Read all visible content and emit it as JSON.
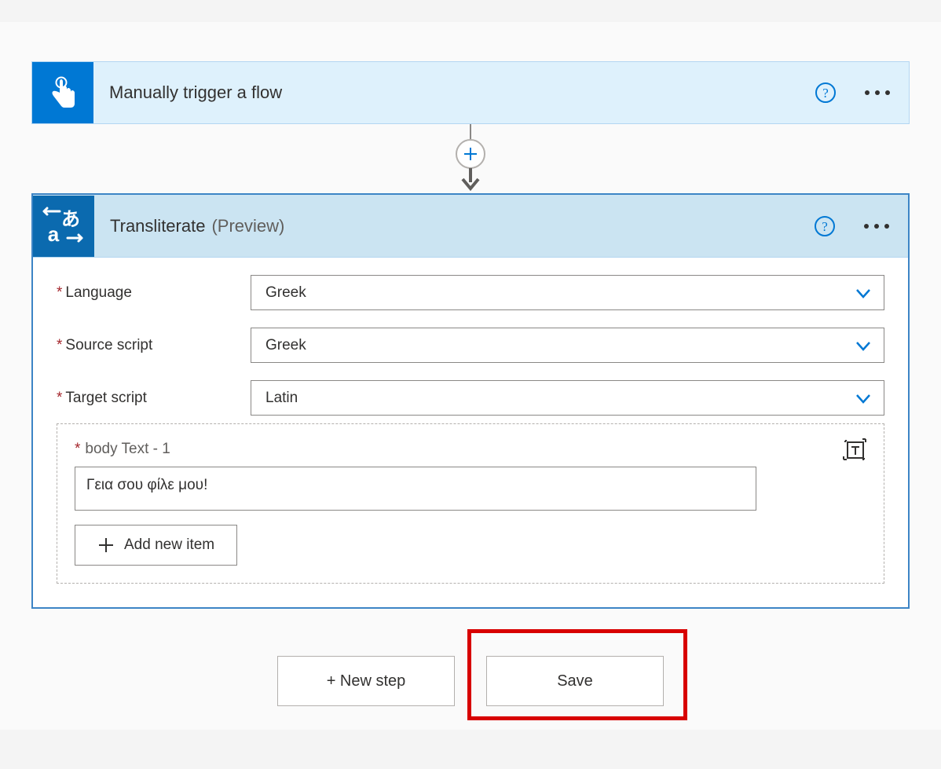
{
  "trigger": {
    "title": "Manually trigger a flow"
  },
  "action": {
    "title": "Transliterate",
    "preview": "(Preview)",
    "fields": {
      "language_label": "Language",
      "language_value": "Greek",
      "source_label": "Source script",
      "source_value": "Greek",
      "target_label": "Target script",
      "target_value": "Latin"
    },
    "body_label": "body Text - 1",
    "body_value": "Γεια σου φίλε μου!",
    "add_item_label": "Add new item"
  },
  "footer": {
    "new_step": "+ New step",
    "save": "Save"
  }
}
